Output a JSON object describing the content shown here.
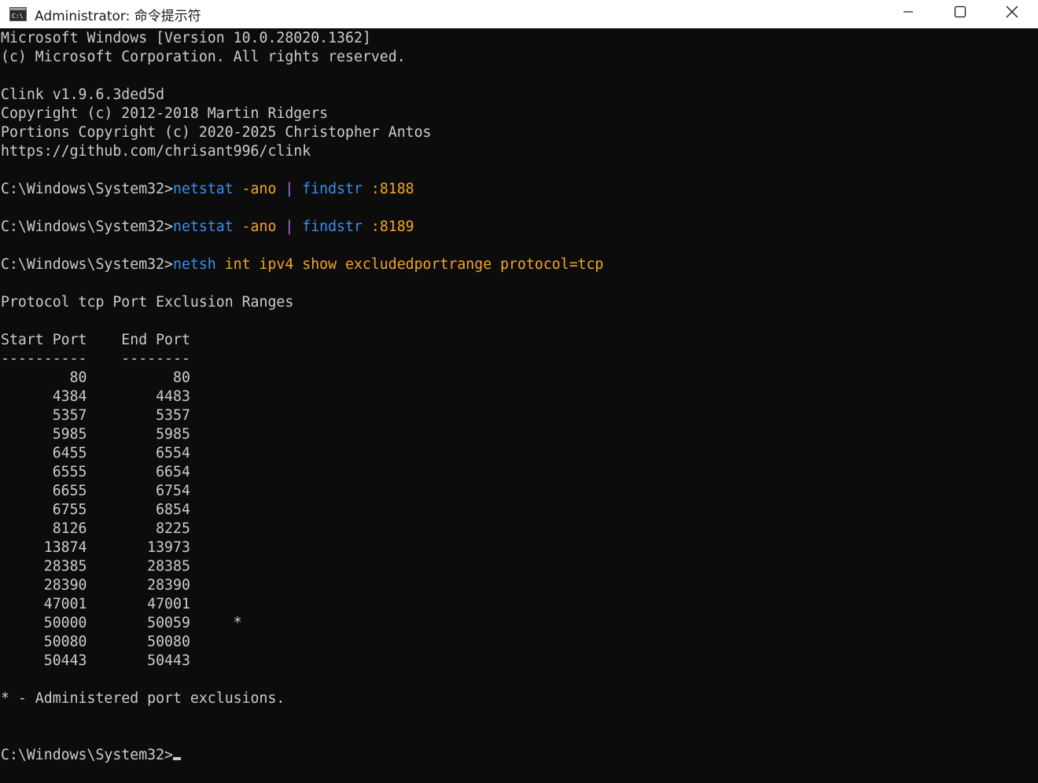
{
  "window": {
    "title": "Administrator: 命令提示符",
    "icon": "cmd-icon",
    "controls": {
      "minimize": "minimize-icon",
      "maximize": "maximize-icon",
      "close": "close-icon"
    }
  },
  "colors": {
    "background": "#0c0c0c",
    "text": "#cccccc",
    "command": "#3b8eea",
    "argument": "#f5a524",
    "pipe": "#b46be2",
    "titlebar": "#ffffff"
  },
  "terminal": {
    "banner": [
      "Microsoft Windows [Version 10.0.28020.1362]",
      "(c) Microsoft Corporation. All rights reserved."
    ],
    "clink": [
      "Clink v1.9.6.3ded5d",
      "Copyright (c) 2012-2018 Martin Ridgers",
      "Portions Copyright (c) 2020-2025 Christopher Antos",
      "https://github.com/chrisant996/clink"
    ],
    "prompt": "C:\\Windows\\System32>",
    "commands": [
      {
        "cmd": "netstat",
        "args": " -ano ",
        "pipe": "|",
        "cmd2": " findstr",
        "args2": " :8188"
      },
      {
        "cmd": "netstat",
        "args": " -ano ",
        "pipe": "|",
        "cmd2": " findstr",
        "args2": " :8189"
      },
      {
        "cmd": "netsh",
        "args": " int ipv4 show excludedportrange protocol=tcp"
      }
    ],
    "output_heading": "Protocol tcp Port Exclusion Ranges",
    "table_header": "Start Port    End Port",
    "table_rule": "----------    --------",
    "rows": [
      "        80          80",
      "      4384        4483",
      "      5357        5357",
      "      5985        5985",
      "      6455        6554",
      "      6555        6654",
      "      6655        6754",
      "      6755        6854",
      "      8126        8225",
      "     13874       13973",
      "     28385       28385",
      "     28390       28390",
      "     47001       47001",
      "     50000       50059     *",
      "     50080       50080",
      "     50443       50443"
    ],
    "footnote": "* - Administered port exclusions."
  }
}
